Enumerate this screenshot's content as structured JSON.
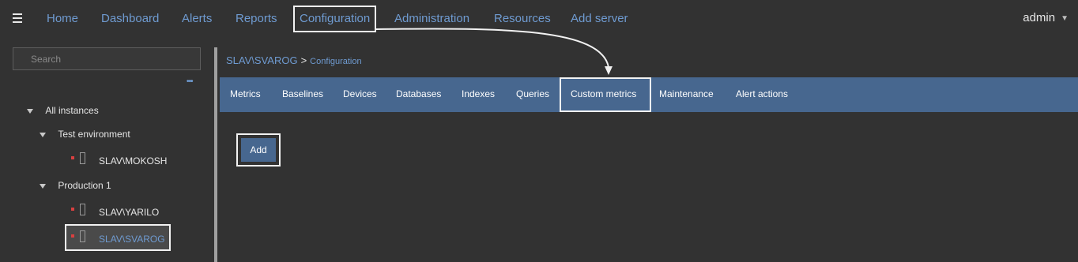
{
  "topnav": {
    "items": [
      "Home",
      "Dashboard",
      "Alerts",
      "Reports",
      "Configuration",
      "Administration",
      "Resources",
      "Add server"
    ],
    "user": "admin"
  },
  "sidebar": {
    "search_placeholder": "Search",
    "tree": {
      "root": "All instances",
      "groups": [
        {
          "label": "Test environment",
          "servers": [
            "SLAV\\MOKOSH"
          ]
        },
        {
          "label": "Production 1",
          "servers": [
            "SLAV\\YARILO",
            "SLAV\\SVAROG"
          ]
        }
      ]
    }
  },
  "main": {
    "breadcrumb": {
      "server": "SLAV\\SVAROG",
      "page": "Configuration"
    },
    "tabs": [
      "Metrics",
      "Baselines",
      "Devices",
      "Databases",
      "Indexes",
      "Queries",
      "Custom metrics",
      "Maintenance",
      "Alert actions"
    ],
    "add_label": "Add"
  }
}
